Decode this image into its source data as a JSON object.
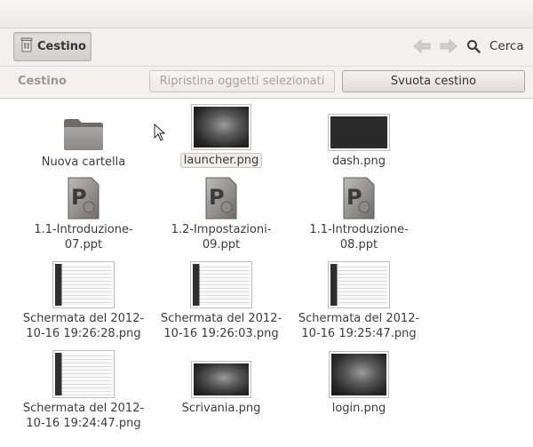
{
  "toolbar": {
    "location_label": "Cestino",
    "search_label": "Cerca"
  },
  "infobar": {
    "title": "Cestino",
    "restore_label": "Ripristina oggetti selezionati",
    "empty_label": "Svuota cestino"
  },
  "files": [
    {
      "name": "Nuova cartella",
      "icon": "folder-icon"
    },
    {
      "name": "launcher.png",
      "icon": "image-thumbnail-icon",
      "selected": true
    },
    {
      "name": "dash.png",
      "icon": "image-thumbnail-icon"
    },
    {
      "name": "1.1-Introduzione-07.ppt",
      "icon": "presentation-file-icon"
    },
    {
      "name": "1.2-Impostazioni-09.ppt",
      "icon": "presentation-file-icon"
    },
    {
      "name": "1.1-Introduzione-08.ppt",
      "icon": "presentation-file-icon"
    },
    {
      "name": "Schermata del 2012-10-16 19:26:28.png",
      "icon": "screenshot-thumbnail-icon"
    },
    {
      "name": "Schermata del 2012-10-16 19:26:03.png",
      "icon": "screenshot-thumbnail-icon"
    },
    {
      "name": "Schermata del 2012-10-16 19:25:47.png",
      "icon": "screenshot-thumbnail-icon"
    },
    {
      "name": "Schermata del 2012-10-16 19:24:47.png",
      "icon": "screenshot-thumbnail-icon"
    },
    {
      "name": "Scrivania.png",
      "icon": "image-thumbnail-icon"
    },
    {
      "name": "login.png",
      "icon": "image-thumbnail-icon"
    }
  ]
}
